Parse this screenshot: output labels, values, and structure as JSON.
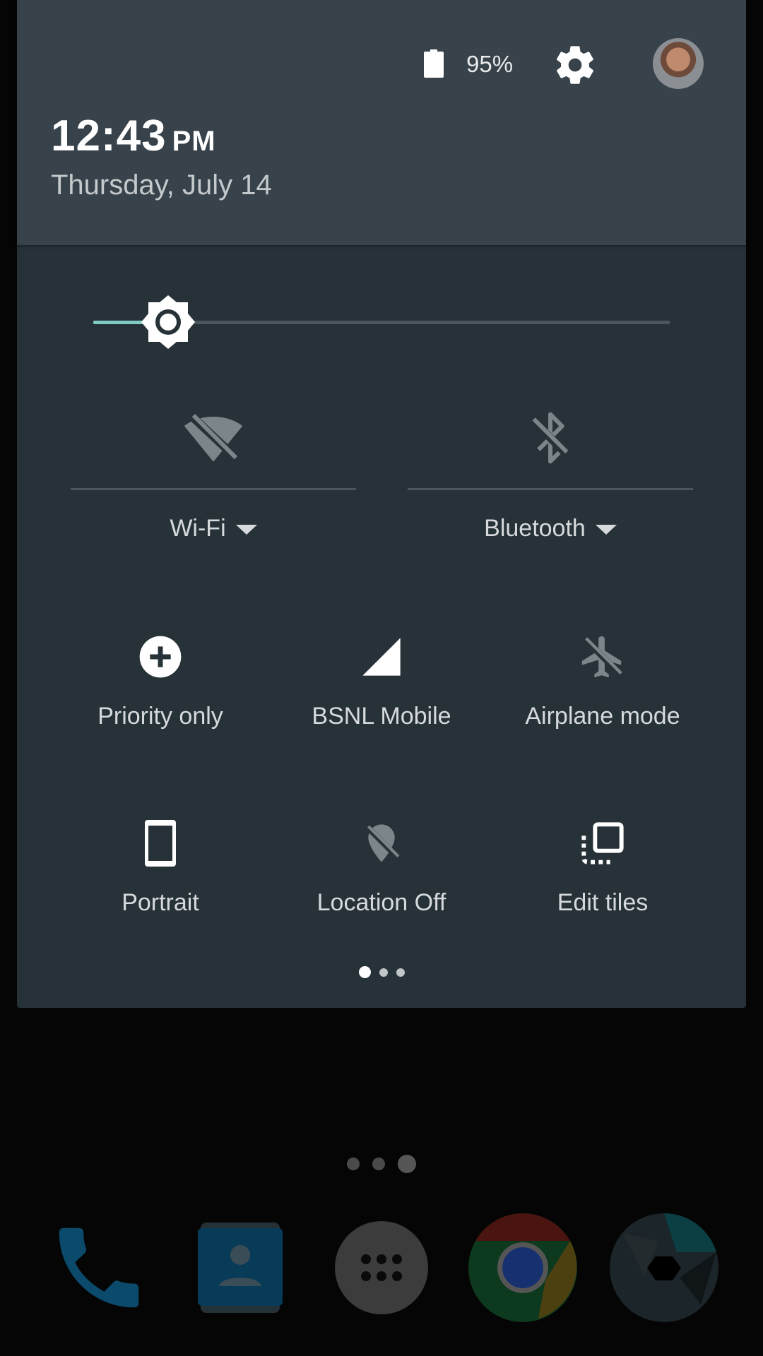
{
  "status": {
    "battery_percent": "95%"
  },
  "header": {
    "time": "12:43",
    "ampm": "PM",
    "date": "Thursday, July 14"
  },
  "brightness": {
    "level": 0.13,
    "accent_color": "#80cbc4"
  },
  "big_tiles": [
    {
      "label": "Wi-Fi",
      "icon": "wifi-off-icon"
    },
    {
      "label": "Bluetooth",
      "icon": "bluetooth-disabled-icon"
    }
  ],
  "tiles": [
    {
      "label": "Priority only",
      "icon": "priority-only-icon"
    },
    {
      "label": "BSNL Mobile",
      "icon": "cellular-signal-icon"
    },
    {
      "label": "Airplane mode",
      "icon": "airplane-icon"
    },
    {
      "label": "Portrait",
      "icon": "portrait-phone-icon"
    },
    {
      "label": "Location Off",
      "icon": "location-off-icon"
    },
    {
      "label": "Edit tiles",
      "icon": "edit-tiles-icon"
    }
  ],
  "pager": {
    "pages": 3,
    "current": 1
  },
  "dock": {
    "apps": [
      "phone-icon",
      "contacts-icon",
      "app-drawer-icon",
      "chrome-icon",
      "camera-icon"
    ]
  },
  "colors": {
    "shade_bg": "#263238",
    "header_bg": "#37424a",
    "accent": "#80cbc4"
  }
}
